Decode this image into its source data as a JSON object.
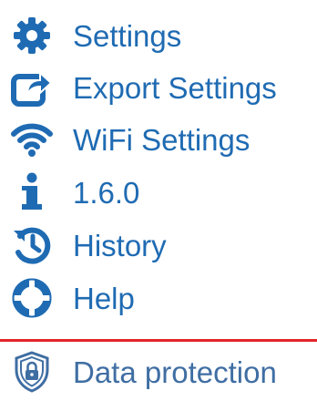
{
  "menu": {
    "items": [
      {
        "key": "settings",
        "label": "Settings",
        "icon": "gear-icon"
      },
      {
        "key": "export",
        "label": "Export Settings",
        "icon": "share-arrow-icon"
      },
      {
        "key": "wifi",
        "label": "WiFi Settings",
        "icon": "wifi-icon"
      },
      {
        "key": "version",
        "label": "1.6.0",
        "icon": "info-icon"
      },
      {
        "key": "history",
        "label": "History",
        "icon": "history-icon"
      },
      {
        "key": "help",
        "label": "Help",
        "icon": "lifebuoy-icon"
      }
    ],
    "footer_item": {
      "key": "data-protection",
      "label": "Data protection",
      "icon": "shield-lock-icon"
    }
  },
  "colors": {
    "accent": "#1f6bb3",
    "divider": "#e3262a"
  }
}
